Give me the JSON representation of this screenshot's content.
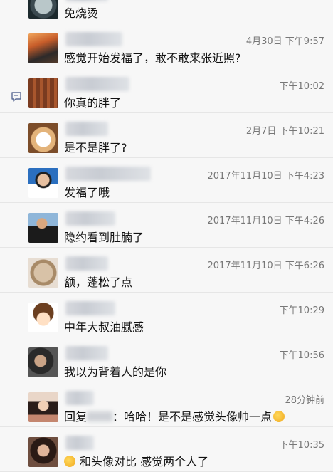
{
  "rows": [
    {
      "time": "",
      "text": "免烧烫"
    },
    {
      "time": "4月30日 下午9:57",
      "text": "感觉开始发福了，敢不敢来张近照?"
    },
    {
      "time": "下午10:02",
      "text": "你真的胖了"
    },
    {
      "time": "2月7日 下午10:21",
      "text": "是不是胖了?"
    },
    {
      "time": "2017年11月10日 下午4:23",
      "text": "发福了哦"
    },
    {
      "time": "2017年11月10日 下午4:26",
      "text": "隐约看到肚腩了"
    },
    {
      "time": "2017年11月10日 下午6:26",
      "text": "额，蓬松了点"
    },
    {
      "time": "下午10:29",
      "text": "中年大叔油腻感"
    },
    {
      "time": "下午10:56",
      "text": "我以为背着人的是你"
    },
    {
      "time": "28分钟前",
      "text_prefix": "回复",
      "text": "：哈哈！是不是感觉头像帅一点"
    },
    {
      "time": "下午10:35",
      "text": "和头像对比 感觉两个人了"
    }
  ],
  "colors": {
    "background": "#f7f7f7",
    "divider": "#e6e6e6",
    "time": "#777777",
    "icon": "#5b6b95"
  },
  "icons": {
    "comment": "comment-icon",
    "emoji_thinking": "thinking-emoji-icon",
    "emoji_laugh": "laugh-emoji-icon"
  }
}
